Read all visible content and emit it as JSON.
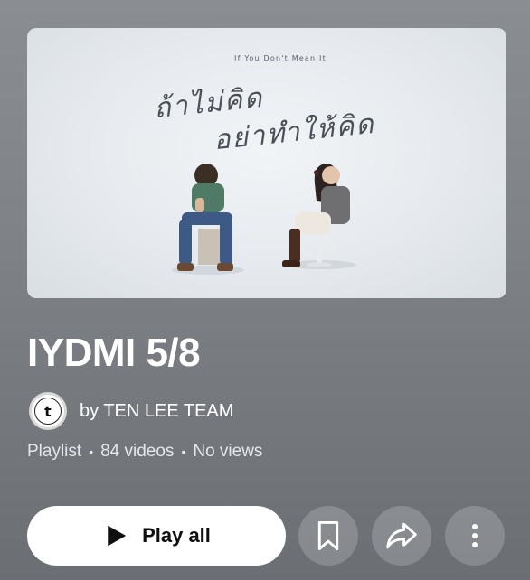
{
  "thumbnail": {
    "subtitle": "If You Don't Mean It",
    "title_line1": "ถ้าไม่คิด",
    "title_line2": "อย่าทำให้คิด"
  },
  "playlist": {
    "title": "IYDMI 5/8",
    "owner_prefix": "by TEN LEE TEAM",
    "type": "Playlist",
    "video_count": "84 videos",
    "views": "No views"
  },
  "actions": {
    "play_all": "Play all"
  },
  "icons": {
    "play": "play-icon",
    "save": "bookmark-icon",
    "share": "share-icon",
    "more": "more-vert-icon"
  },
  "colors": {
    "primary_button": "#ffffff",
    "text": "#ffffff"
  }
}
